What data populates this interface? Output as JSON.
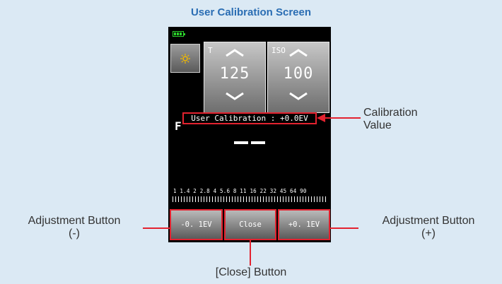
{
  "page": {
    "title": "User Calibration Screen"
  },
  "device": {
    "tiles": [
      {
        "label": "T",
        "value": "125"
      },
      {
        "label": "ISO",
        "value": "100"
      }
    ],
    "calibration_text": "User Calibration : +0.0EV",
    "f_label": "F",
    "aperture_scale": "1  1.4  2  2.8  4  5.6  8  11  16  22  32  45  64  90",
    "buttons": {
      "minus": "-0. 1EV",
      "close": "Close",
      "plus": "+0. 1EV"
    }
  },
  "callouts": {
    "calibration_value": [
      "Calibration",
      "Value"
    ],
    "adjust_left": [
      "Adjustment Button",
      "(-)"
    ],
    "adjust_right": [
      "Adjustment Button",
      "(+)"
    ],
    "close": "[Close] Button"
  },
  "colors": {
    "title": "#2a6db3",
    "highlight": "#e3222f",
    "background": "#dbe9f4"
  }
}
